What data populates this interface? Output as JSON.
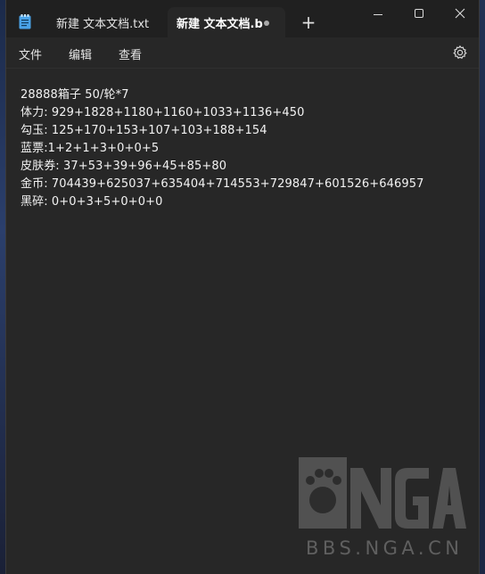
{
  "tabs": [
    {
      "label": "新建 文本文档.txt",
      "active": false
    },
    {
      "label": "新建 文本文档.b",
      "active": true,
      "unsaved": true
    }
  ],
  "titlebar": {
    "new_tab_symbol": "+"
  },
  "menu": {
    "file": "文件",
    "edit": "编辑",
    "view": "查看"
  },
  "editor": {
    "lines": [
      "28888箱子 50/轮*7",
      "体力: 929+1828+1180+1160+1033+1136+450",
      "勾玉: 125+170+153+107+103+188+154",
      "蓝票:1+2+1+3+0+0+5",
      "皮肤券: 37+53+39+96+45+85+80",
      "金币: 704439+625037+635404+714553+729847+601526+646957",
      "黑碎: 0+0+3+5+0+0+0"
    ]
  },
  "watermark": {
    "text": "BBS.NGA.CN"
  },
  "colors": {
    "titlebar": "#202020",
    "editor_bg": "#272727",
    "text": "#f2f2f2"
  }
}
